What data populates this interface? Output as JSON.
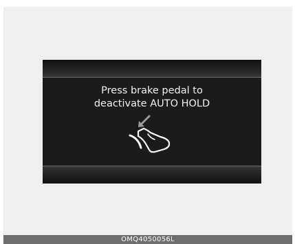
{
  "display": {
    "message_line1": "Press brake pedal to",
    "message_line2": "deactivate AUTO HOLD",
    "icon": "brake-pedal-press-icon"
  },
  "caption": {
    "code": "OMQ4050056L"
  },
  "colors": {
    "display_bg": "#1b1b1b",
    "text": "#f2f2f2",
    "frame_bg": "#efefef",
    "caption_bg": "#6e6e6e"
  }
}
